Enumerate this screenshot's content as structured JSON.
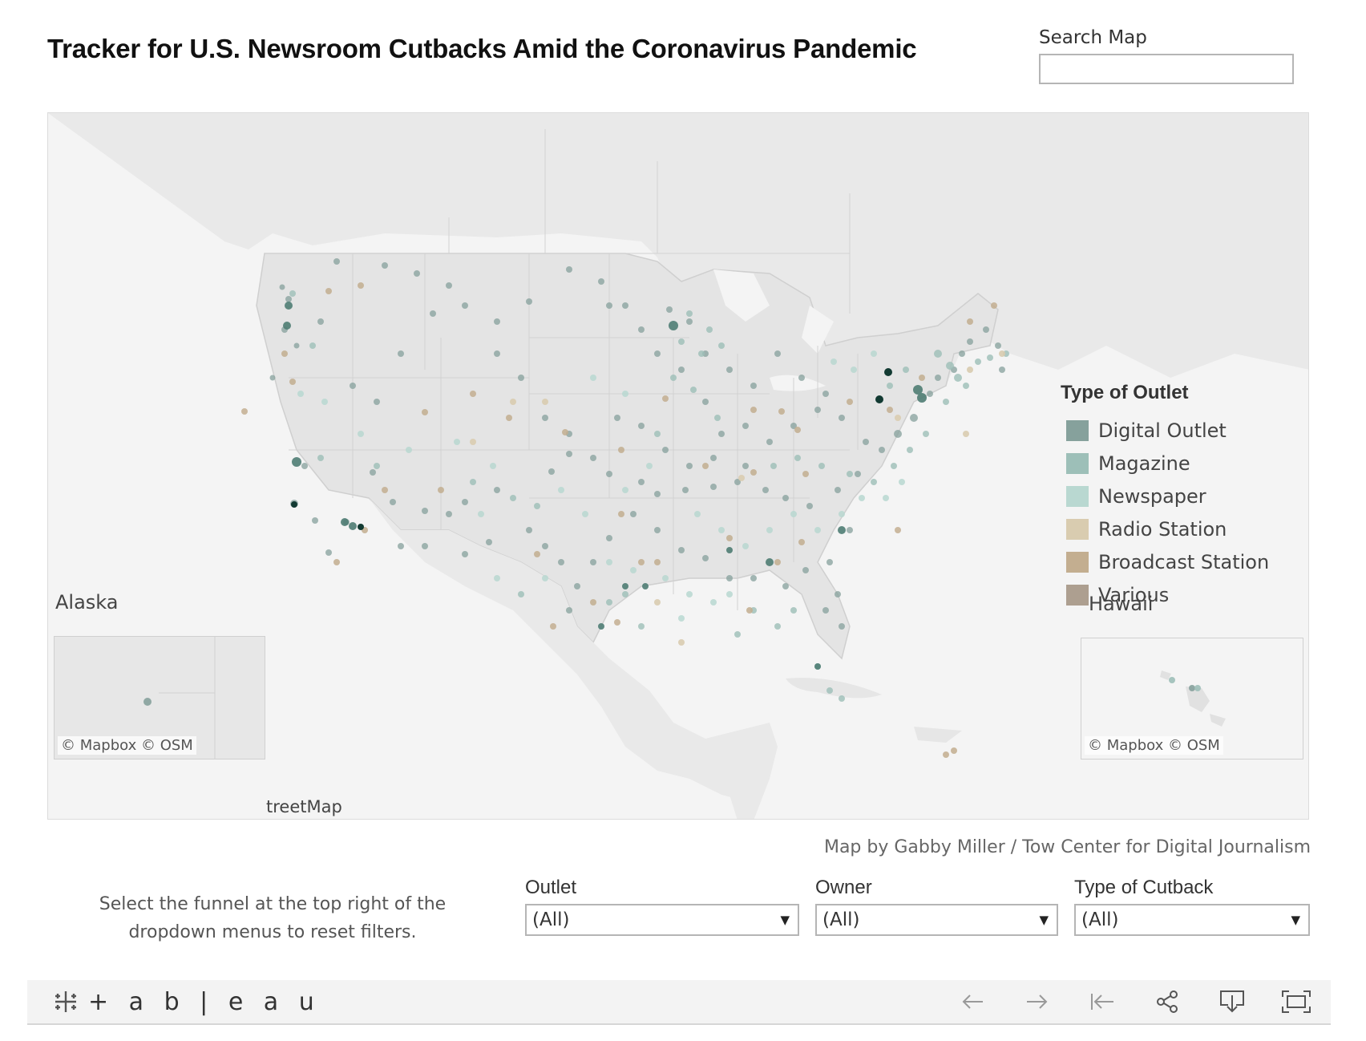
{
  "title": "Tracker for U.S. Newsroom Cutbacks Amid the Coronavirus Pandemic",
  "search": {
    "label": "Search Map",
    "value": "",
    "placeholder": ""
  },
  "map": {
    "insets": {
      "alaska": "Alaska",
      "hawaii": "Hawaii"
    },
    "attribution": "© Mapbox  © OSM",
    "attribution_tail": "treetMap"
  },
  "legend": {
    "title": "Type of Outlet",
    "items": [
      {
        "label": "Digital Outlet",
        "color": "#86a19c"
      },
      {
        "label": "Magazine",
        "color": "#9dbfb8"
      },
      {
        "label": "Newspaper",
        "color": "#b9d8d1"
      },
      {
        "label": "Radio Station",
        "color": "#d9ccb0"
      },
      {
        "label": "Broadcast Station",
        "color": "#c3ae90"
      },
      {
        "label": "Various",
        "color": "#ad9f90"
      }
    ]
  },
  "credit": "Map by Gabby Miller / Tow Center for Digital Journalism",
  "note": "Select the funnel at the top right of the dropdown menus to reset filters.",
  "filters": [
    {
      "label": "Outlet",
      "value": "(All)"
    },
    {
      "label": "Owner",
      "value": "(All)"
    },
    {
      "label": "Type of Cutback",
      "value": "(All)"
    }
  ],
  "toolbar": {
    "logo": "+ a b | e a u",
    "icons": [
      "undo-icon",
      "redo-icon",
      "revert-icon",
      "share-icon",
      "download-icon",
      "fullscreen-icon"
    ]
  }
}
